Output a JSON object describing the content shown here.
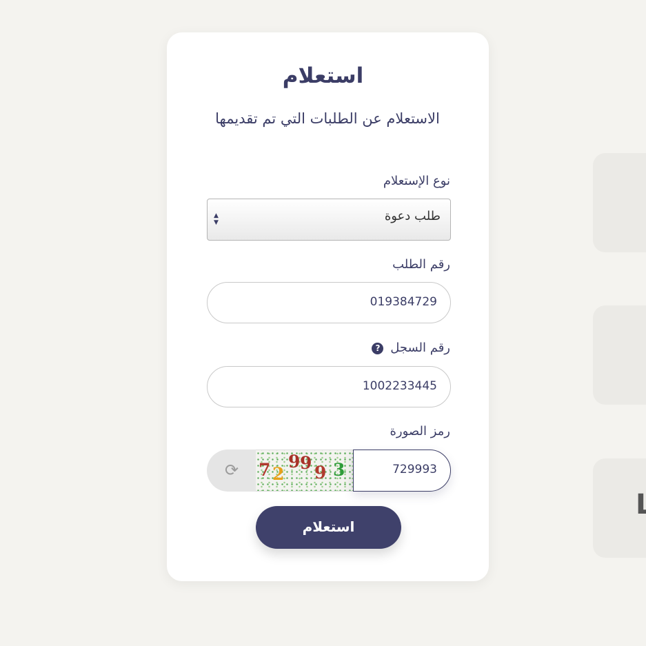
{
  "form": {
    "title": "استعلام",
    "subtitle": "الاستعلام عن الطلبات التي تم تقديمها",
    "inquiry_type": {
      "label": "نوع الإستعلام",
      "selected": "طلب دعوة"
    },
    "request_number": {
      "label": "رقم الطلب",
      "value": "019384729"
    },
    "record_number": {
      "label": "رقم السجل",
      "value": "1002233445",
      "help_icon": "question-circle-icon"
    },
    "captcha": {
      "label": "رمز الصورة",
      "value": "729993",
      "refresh_icon": "refresh-icon",
      "image_digits": [
        "7",
        "2",
        "9",
        "9",
        "9",
        "3"
      ]
    },
    "submit_label": "استعلام"
  },
  "side_cards": {
    "fragment_text": "L"
  },
  "colors": {
    "background": "#f4f3ef",
    "card": "#ffffff",
    "primary": "#3f416b",
    "text": "#3b3d66"
  }
}
